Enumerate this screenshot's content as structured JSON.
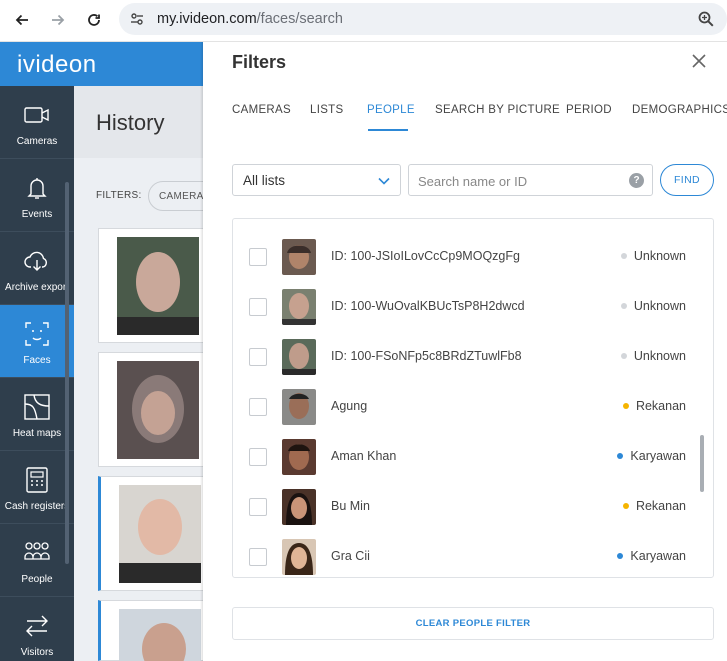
{
  "browser": {
    "url_host": "my.ivideon.com",
    "url_path": "/faces/search"
  },
  "app": {
    "logo": "ivideon"
  },
  "sidebar": {
    "items": [
      {
        "label": "Cameras",
        "icon": "camera-icon"
      },
      {
        "label": "Events",
        "icon": "bell-icon"
      },
      {
        "label": "Archive export",
        "icon": "cloud-download-icon"
      },
      {
        "label": "Faces",
        "icon": "face-scan-icon",
        "active": true
      },
      {
        "label": "Heat maps",
        "icon": "heatmap-icon"
      },
      {
        "label": "Cash registers",
        "icon": "cash-register-icon"
      },
      {
        "label": "People",
        "icon": "people-icon"
      },
      {
        "label": "Visitors",
        "icon": "arrows-icon"
      }
    ]
  },
  "page": {
    "title": "History",
    "filters_label": "FILTERS:",
    "cameras_pill": "CAMERAS"
  },
  "panel": {
    "title": "Filters",
    "tabs": [
      {
        "label": "CAMERAS"
      },
      {
        "label": "LISTS"
      },
      {
        "label": "PEOPLE",
        "active": true
      },
      {
        "label": "SEARCH BY PICTURE"
      },
      {
        "label": "PERIOD"
      },
      {
        "label": "DEMOGRAPHICS"
      }
    ],
    "list_select": {
      "value": "All lists"
    },
    "search": {
      "placeholder": "Search name or ID",
      "help": "?"
    },
    "find_label": "FIND",
    "people": [
      {
        "name": "ID: 100-JSIoILovCcCp9MOQzgFg",
        "status": "Unknown",
        "color": "#d3d6da"
      },
      {
        "name": "ID: 100-WuOvalKBUcTsP8H2dwcd",
        "status": "Unknown",
        "color": "#d3d6da"
      },
      {
        "name": "ID: 100-FSoNFp5c8BRdZTuwlFb8",
        "status": "Unknown",
        "color": "#d3d6da"
      },
      {
        "name": "Agung",
        "status": "Rekanan",
        "color": "#f5b400"
      },
      {
        "name": "Aman Khan",
        "status": "Karyawan",
        "color": "#2d88d6"
      },
      {
        "name": "Bu Min",
        "status": "Rekanan",
        "color": "#f5b400"
      },
      {
        "name": "Gra Cii",
        "status": "Karyawan",
        "color": "#2d88d6"
      }
    ],
    "clear_label": "CLEAR PEOPLE FILTER"
  },
  "colors": {
    "accent": "#2d88d6",
    "sidebar": "#2f3e4c"
  }
}
